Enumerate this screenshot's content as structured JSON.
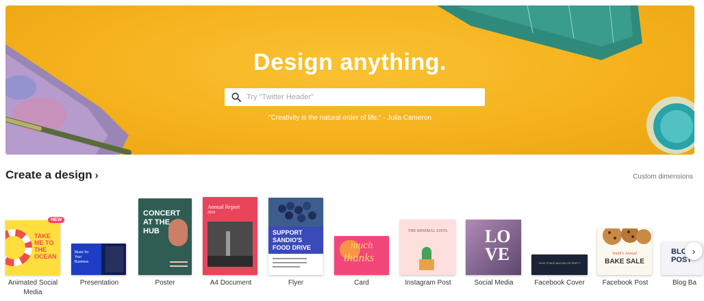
{
  "hero": {
    "title": "Design anything.",
    "search_placeholder": "Try \"Twitter Header\"",
    "quote": "\"Creativity is the natural order of life.\" - Julia Cameron",
    "icons": [
      "search-icon"
    ]
  },
  "section": {
    "title": "Create a design",
    "chevron": "›",
    "custom_dimensions": "Custom dimensions"
  },
  "designs": [
    {
      "label": "Animated Social Media",
      "badge": "NEW",
      "thumb_text": [
        "TAKE",
        "ME TO",
        "THE",
        "OCEAN"
      ]
    },
    {
      "label": "Presentation",
      "thumb_text": [
        "Music for",
        "Your",
        "Business"
      ]
    },
    {
      "label": "Poster",
      "thumb_text": [
        "CONCERT",
        "AT THE",
        "HUB"
      ]
    },
    {
      "label": "A4 Document",
      "thumb_text": [
        "Annual Report",
        "2019"
      ]
    },
    {
      "label": "Flyer",
      "thumb_text": [
        "SUPPORT",
        "SANDIO'S",
        "FOOD DRIVE"
      ]
    },
    {
      "label": "Card",
      "thumb_text": [
        "much",
        "thanks"
      ]
    },
    {
      "label": "Instagram Post",
      "thumb_text": [
        "THE MINIMAL LISTS"
      ]
    },
    {
      "label": "Social Media",
      "thumb_text": [
        "LO",
        "VE"
      ]
    },
    {
      "label": "Facebook Cover",
      "thumb_text": [
        "HIGH STAKE BACHELOR PARTY"
      ]
    },
    {
      "label": "Facebook Post",
      "thumb_text": [
        "Smith's Annual",
        "BAKE SALE"
      ]
    },
    {
      "label": "Blog Ba",
      "thumb_text": [
        "BLOG",
        "POST"
      ]
    }
  ],
  "next_button": "›",
  "colors": {
    "hero_bg": "#f5b21d",
    "badge": "#ff3f6a",
    "text": "#222222"
  }
}
